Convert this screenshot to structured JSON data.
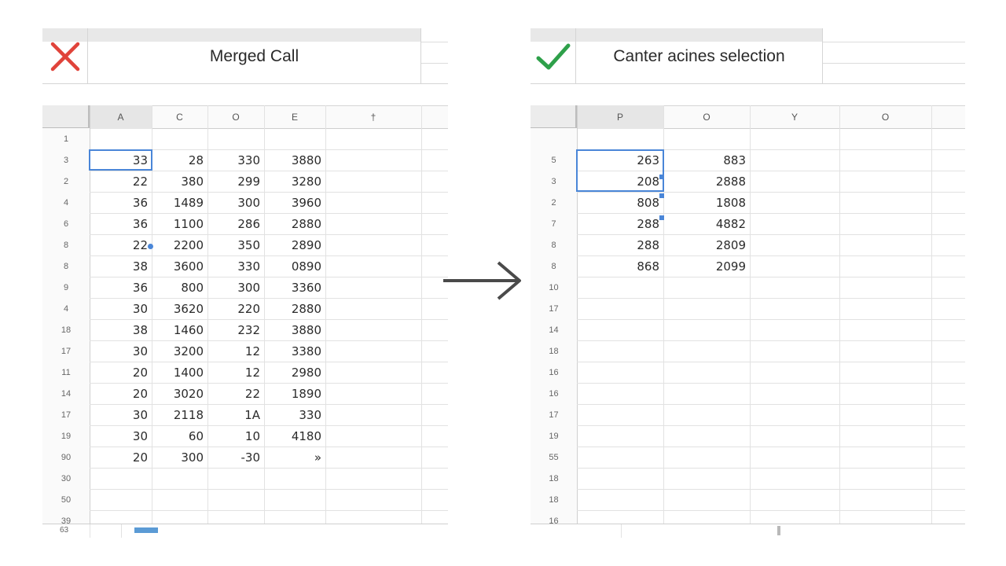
{
  "left": {
    "title": "Merged Call",
    "status_icon": "x-mark-icon",
    "status_color": "#e0433a",
    "columns": [
      "A",
      "C",
      "O",
      "E",
      "†"
    ],
    "rows": [
      {
        "h": "1",
        "v": [
          "",
          "",
          "",
          ""
        ]
      },
      {
        "h": "3",
        "v": [
          "33",
          "28",
          "330",
          "3880"
        ]
      },
      {
        "h": "2",
        "v": [
          "22",
          "380",
          "299",
          "3280"
        ]
      },
      {
        "h": "4",
        "v": [
          "36",
          "1489",
          "300",
          "3960"
        ]
      },
      {
        "h": "6",
        "v": [
          "36",
          "1100",
          "286",
          "2880"
        ]
      },
      {
        "h": "8",
        "v": [
          "22",
          "2200",
          "350",
          "2890"
        ]
      },
      {
        "h": "8",
        "v": [
          "38",
          "3600",
          "330",
          "0890"
        ]
      },
      {
        "h": "9",
        "v": [
          "36",
          "800",
          "300",
          "3360"
        ]
      },
      {
        "h": "4",
        "v": [
          "30",
          "3620",
          "220",
          "2880"
        ]
      },
      {
        "h": "18",
        "v": [
          "38",
          "1460",
          "232",
          "3880"
        ]
      },
      {
        "h": "17",
        "v": [
          "30",
          "3200",
          "12",
          "3380"
        ]
      },
      {
        "h": "11",
        "v": [
          "20",
          "1400",
          "12",
          "2980"
        ]
      },
      {
        "h": "14",
        "v": [
          "20",
          "3020",
          "22",
          "1890"
        ]
      },
      {
        "h": "17",
        "v": [
          "30",
          "2118",
          "1A",
          "330"
        ]
      },
      {
        "h": "19",
        "v": [
          "30",
          "60",
          "10",
          "4180"
        ]
      },
      {
        "h": "90",
        "v": [
          "20",
          "300",
          "-30",
          "»"
        ]
      },
      {
        "h": "30",
        "v": [
          "",
          "",
          "",
          ""
        ]
      },
      {
        "h": "50",
        "v": [
          "",
          "",
          "",
          ""
        ]
      },
      {
        "h": "39",
        "v": [
          "",
          "",
          "",
          ""
        ]
      }
    ],
    "footer_row": "63"
  },
  "right": {
    "title": "Canter acines selection",
    "status_icon": "check-mark-icon",
    "status_color": "#2ea04a",
    "columns": [
      "P",
      "O",
      "Y",
      "O"
    ],
    "rows": [
      {
        "h": "",
        "v": [
          "",
          ""
        ]
      },
      {
        "h": "5",
        "v": [
          "263",
          "883"
        ]
      },
      {
        "h": "3",
        "v": [
          "208",
          "2888"
        ]
      },
      {
        "h": "2",
        "v": [
          "808",
          "1808"
        ]
      },
      {
        "h": "7",
        "v": [
          "288",
          "4882"
        ]
      },
      {
        "h": "8",
        "v": [
          "288",
          "2809"
        ]
      },
      {
        "h": "8",
        "v": [
          "868",
          "2099"
        ]
      },
      {
        "h": "10",
        "v": [
          "",
          ""
        ]
      },
      {
        "h": "17",
        "v": [
          "",
          ""
        ]
      },
      {
        "h": "14",
        "v": [
          "",
          ""
        ]
      },
      {
        "h": "18",
        "v": [
          "",
          ""
        ]
      },
      {
        "h": "16",
        "v": [
          "",
          ""
        ]
      },
      {
        "h": "16",
        "v": [
          "",
          ""
        ]
      },
      {
        "h": "17",
        "v": [
          "",
          ""
        ]
      },
      {
        "h": "19",
        "v": [
          "",
          ""
        ]
      },
      {
        "h": "55",
        "v": [
          "",
          ""
        ]
      },
      {
        "h": "18",
        "v": [
          "",
          ""
        ]
      },
      {
        "h": "18",
        "v": [
          "",
          ""
        ]
      },
      {
        "h": "16",
        "v": [
          "",
          ""
        ]
      }
    ]
  },
  "arrow_icon": "arrow-right-icon",
  "selection_color": "#4a86d8"
}
